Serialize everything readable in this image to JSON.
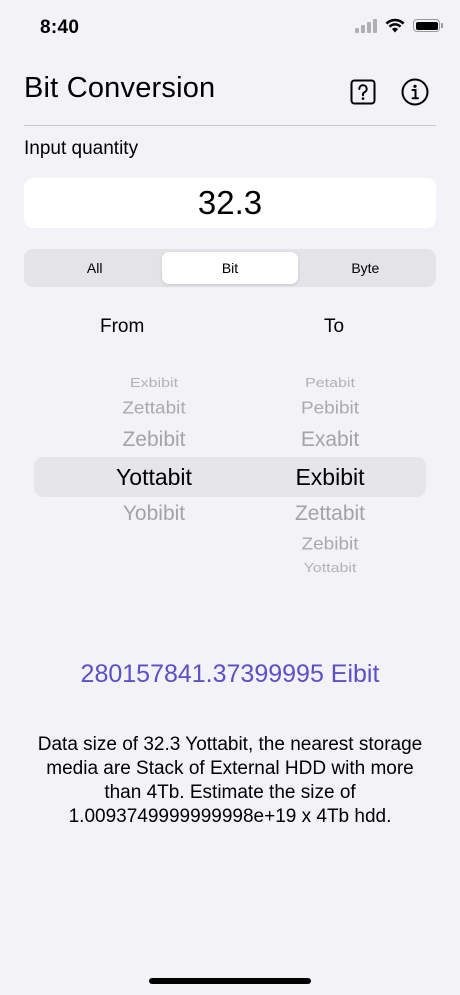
{
  "status": {
    "time": "8:40"
  },
  "header": {
    "title": "Bit Conversion",
    "help_icon": "question-square-icon",
    "info_icon": "info-circle-icon"
  },
  "input": {
    "label": "Input quantity",
    "value": "32.3"
  },
  "segments": {
    "items": [
      "All",
      "Bit",
      "Byte"
    ],
    "selected": "Bit"
  },
  "picker": {
    "from_label": "From",
    "to_label": "To",
    "from_items": [
      "Exbibit",
      "Zettabit",
      "Zebibit",
      "Yottabit",
      "Yobibit"
    ],
    "from_selected": "Yottabit",
    "to_items": [
      "Petabit",
      "Pebibit",
      "Exabit",
      "Exbibit",
      "Zettabit",
      "Zebibit",
      "Yottabit"
    ],
    "to_selected": "Exbibit"
  },
  "result": "280157841.37399995 Eibit",
  "description": "Data size of 32.3 Yottabit, the nearest storage media are Stack of External HDD with more than 4Tb. Estimate the size of 1.0093749999999998e+19 x 4Tb hdd.",
  "colors": {
    "accent": "#5a50c8",
    "background": "#f2f2f7"
  }
}
